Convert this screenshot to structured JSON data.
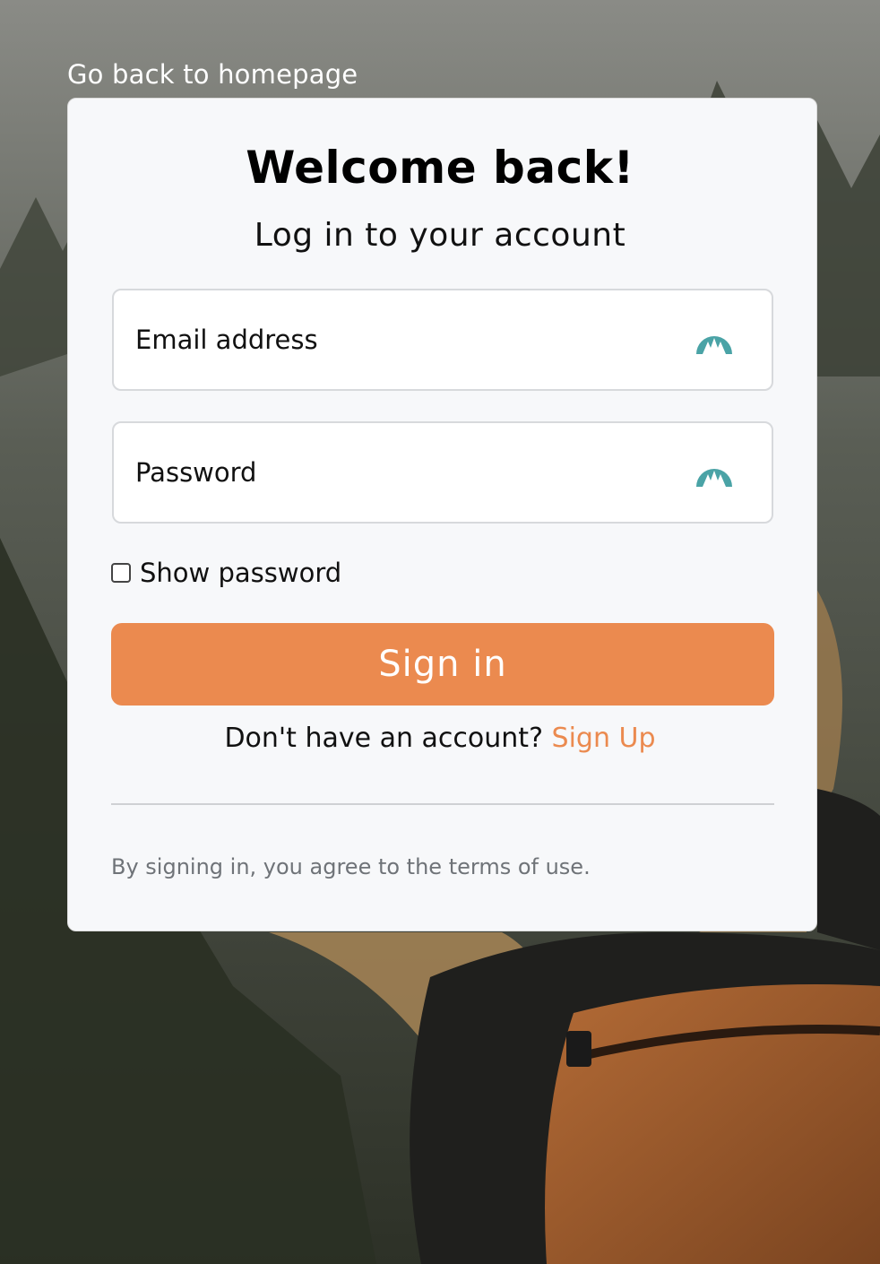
{
  "nav": {
    "back_link": "Go back to homepage"
  },
  "login": {
    "title": "Welcome back!",
    "subtitle": "Log in to your account",
    "email_placeholder": "Email address",
    "password_placeholder": "Password",
    "show_password_label": "Show password",
    "show_password_checked": false,
    "signin_label": "Sign in",
    "signup_prompt": "Don't have an account?",
    "signup_link": "Sign Up",
    "terms": "By signing in, you agree to the terms of use."
  },
  "icons": {
    "field_icon": "password-manager-icon"
  },
  "colors": {
    "accent": "#eb8a4f",
    "field_icon": "#4aa3a6",
    "card_bg": "#f7f8fa"
  }
}
